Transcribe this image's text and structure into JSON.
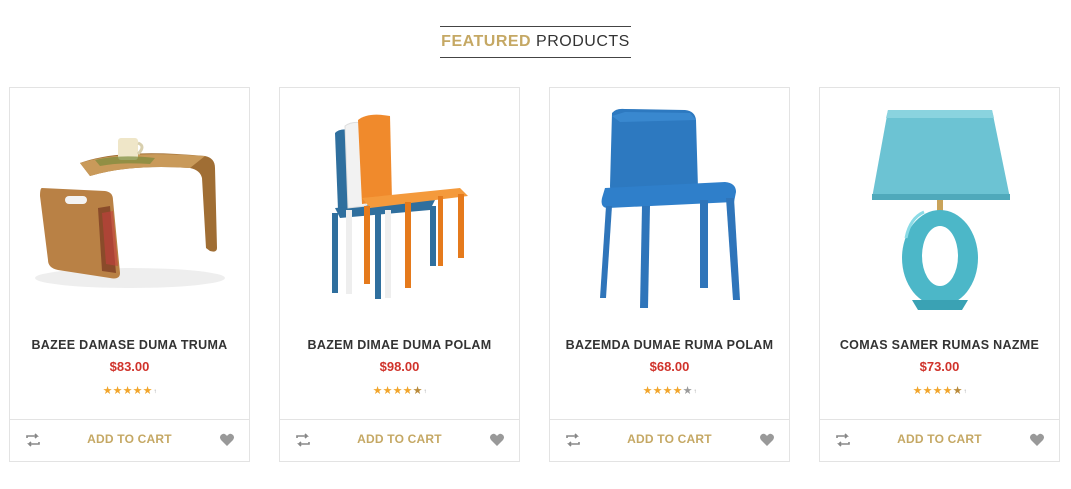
{
  "section": {
    "title_accent": "FEATURED",
    "title_rest": "PRODUCTS"
  },
  "colors": {
    "accent": "#c5a864",
    "price": "#d0332b",
    "star_full": "#f1a52b",
    "star_empty": "#9a9a9a",
    "border": "#e3e3e3"
  },
  "products": [
    {
      "name": "BAZEE DAMASE DUMA TRUMA",
      "price": "$83.00",
      "rating": 5,
      "image": "wooden-side-table-with-mug",
      "add_to_cart": "ADD TO CART",
      "compare_icon": "compare-icon",
      "wishlist_icon": "heart-icon"
    },
    {
      "name": "BAZEM DIMAE DUMA POLAM",
      "price": "$98.00",
      "rating": 4.5,
      "image": "stacked-colorful-chairs",
      "add_to_cart": "ADD TO CART",
      "compare_icon": "compare-icon",
      "wishlist_icon": "heart-icon"
    },
    {
      "name": "BAZEMDA DUMAE RUMA POLAM",
      "price": "$68.00",
      "rating": 4,
      "image": "blue-plastic-chair",
      "add_to_cart": "ADD TO CART",
      "compare_icon": "compare-icon",
      "wishlist_icon": "heart-icon"
    },
    {
      "name": "COMAS SAMER RUMAS NAZME",
      "price": "$73.00",
      "rating": 4.5,
      "image": "turquoise-table-lamp",
      "add_to_cart": "ADD TO CART",
      "compare_icon": "compare-icon",
      "wishlist_icon": "heart-icon"
    }
  ]
}
